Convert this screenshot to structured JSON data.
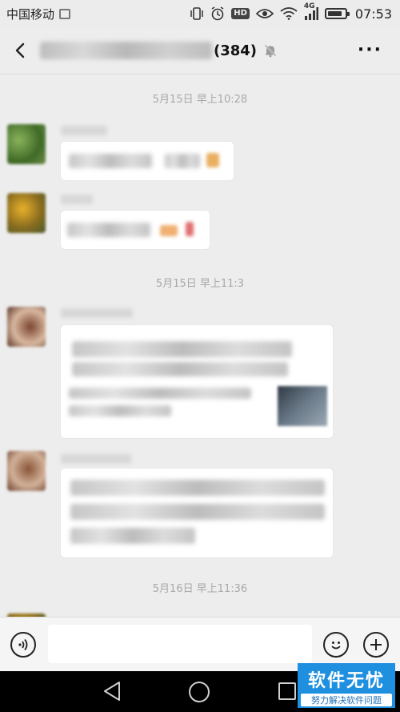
{
  "status_bar": {
    "carrier": "中国移动",
    "hd_label": "HD",
    "network_label": "4G",
    "time": "07:53",
    "battery_level": 0.85
  },
  "header": {
    "member_count": "(384)",
    "back_icon": "back-arrow-icon",
    "mute_icon": "muted-bell-icon",
    "more_icon": "more-dots-icon",
    "more_label": "···"
  },
  "messages": {
    "timestamps": [
      "5月15日 早上10:28",
      "5月15日 早上11:3",
      "5月16日 早上11:36"
    ]
  },
  "input_bar": {
    "voice_icon": "voice-icon",
    "emoji_icon": "emoji-icon",
    "add_icon": "add-icon"
  },
  "watermark": {
    "title": "软件无忧",
    "subtitle": "努力解决软件问题"
  },
  "colors": {
    "background": "#ededed",
    "bubble": "#ffffff",
    "timestamp": "#a8a8a8",
    "watermark": "#1f8fe0"
  }
}
